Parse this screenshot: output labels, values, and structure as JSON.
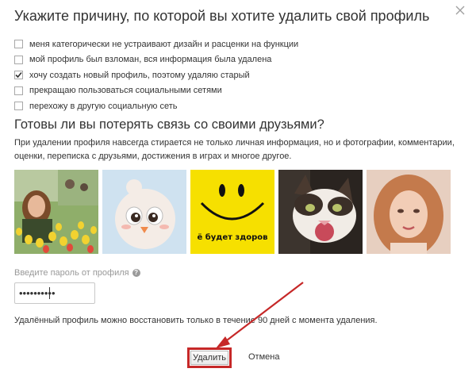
{
  "dialog": {
    "title": "Укажите причину, по которой вы хотите удалить свой профиль",
    "close_icon": "close-icon"
  },
  "reasons": [
    {
      "label": "меня категорически не устраивают дизайн и расценки на функции",
      "checked": false
    },
    {
      "label": "мой профиль был взломан, вся информация была удалена",
      "checked": false
    },
    {
      "label": "хочу создать новый профиль, поэтому удаляю старый",
      "checked": true
    },
    {
      "label": "прекращаю пользоваться социальными сетями",
      "checked": false
    },
    {
      "label": "перехожу в другую социальную сеть",
      "checked": false
    }
  ],
  "friends": {
    "subtitle": "Готовы ли вы потерять связь со своими друзьями?",
    "info": "При удалении профиля навсегда стирается не только личная информация, но и фотографии, комментарии, оценки, переписка с друзьями, достижения в играх и многое другое.",
    "photo_caption_smiley": "ё будет здоров"
  },
  "password": {
    "label": "Введите пароль от профиля",
    "help_icon": "?",
    "value": "••••••••••"
  },
  "note": "Удалённый профиль можно восстановить только в течение 90 дней с момента удаления.",
  "buttons": {
    "delete_label": "Удалить",
    "cancel_label": "Отмена"
  },
  "colors": {
    "highlight": "#c62828",
    "checkbox_border": "#a8a8a8"
  }
}
